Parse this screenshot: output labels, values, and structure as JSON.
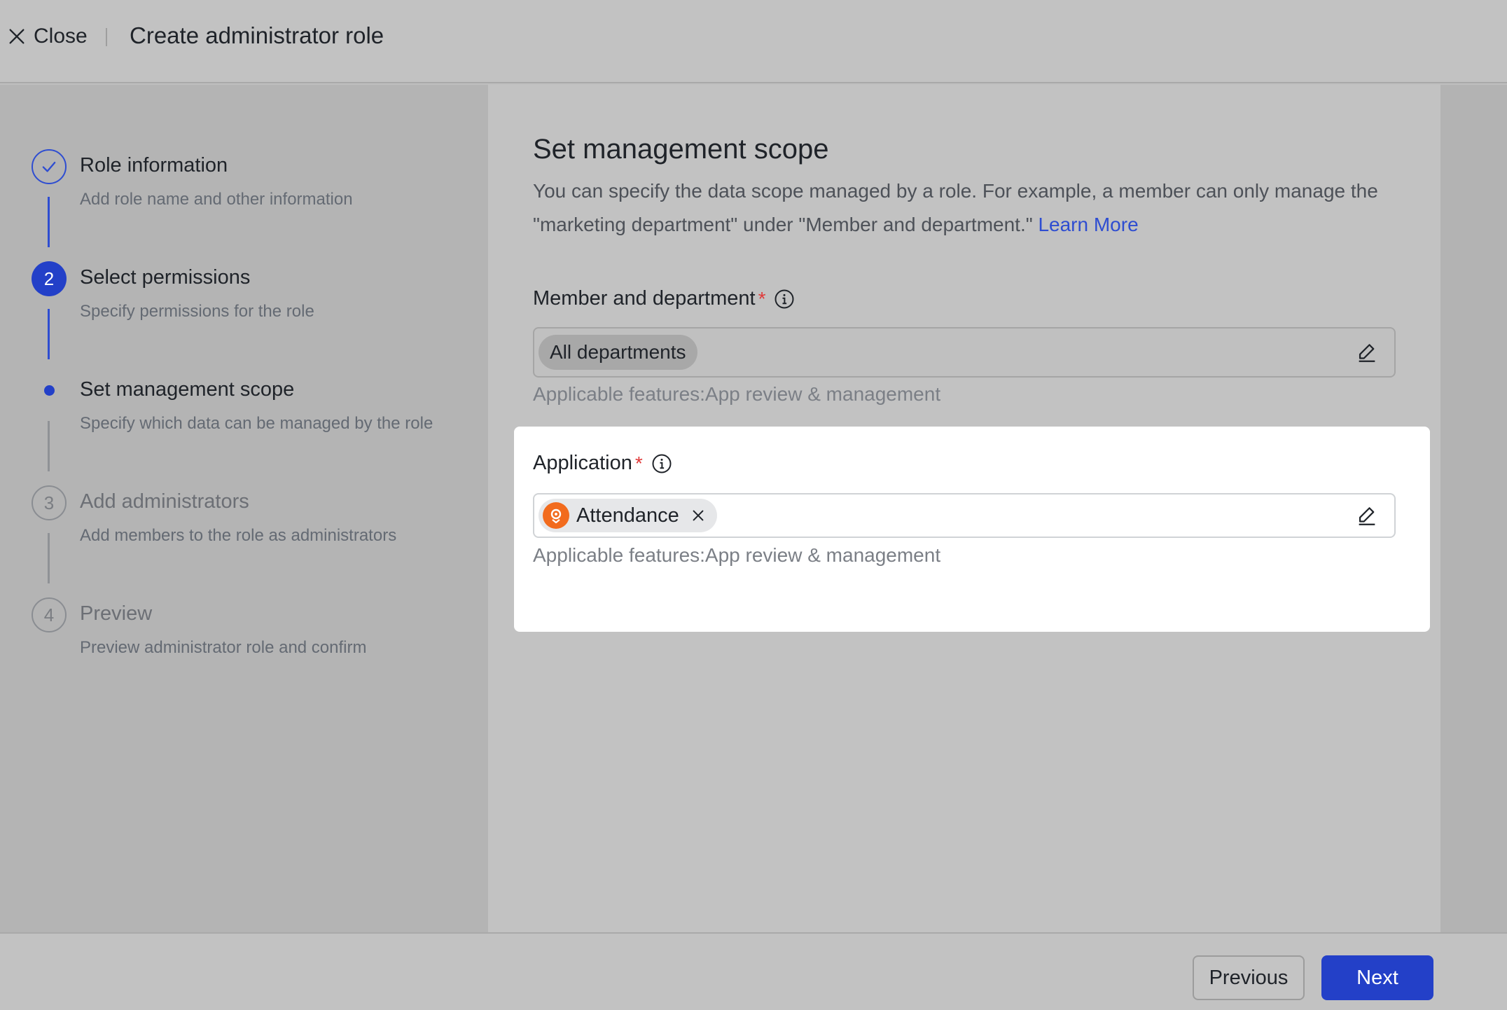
{
  "header": {
    "close_label": "Close",
    "title": "Create administrator role"
  },
  "steps": [
    {
      "title": "Role information",
      "desc": "Add role name and other information",
      "state": "done"
    },
    {
      "number": "2",
      "title": "Select permissions",
      "desc": "Specify permissions for the role",
      "state": "done"
    },
    {
      "title": "Set management scope",
      "desc": "Specify which data can be managed by the role",
      "state": "current"
    },
    {
      "number": "3",
      "title": "Add administrators",
      "desc": "Add members to the role as administrators",
      "state": "pending"
    },
    {
      "number": "4",
      "title": "Preview",
      "desc": "Preview administrator role and confirm",
      "state": "pending"
    }
  ],
  "main": {
    "title": "Set management scope",
    "description": "You can specify the data scope managed by a role. For example, a member can only manage the \"marketing department\" under \"Member and department.\"",
    "learn_more": "Learn More",
    "member_field": {
      "label": "Member and department",
      "required_mark": "*",
      "tag": "All departments",
      "hint": "Applicable features:App review & management"
    },
    "application_field": {
      "label": "Application",
      "required_mark": "*",
      "tag": "Attendance",
      "hint": "Applicable features:App review & management"
    }
  },
  "footer": {
    "previous_label": "Previous",
    "next_label": "Next"
  },
  "colors": {
    "accent": "#2340c8",
    "required": "#e03a3a",
    "app_logo": "#f26b1d"
  }
}
